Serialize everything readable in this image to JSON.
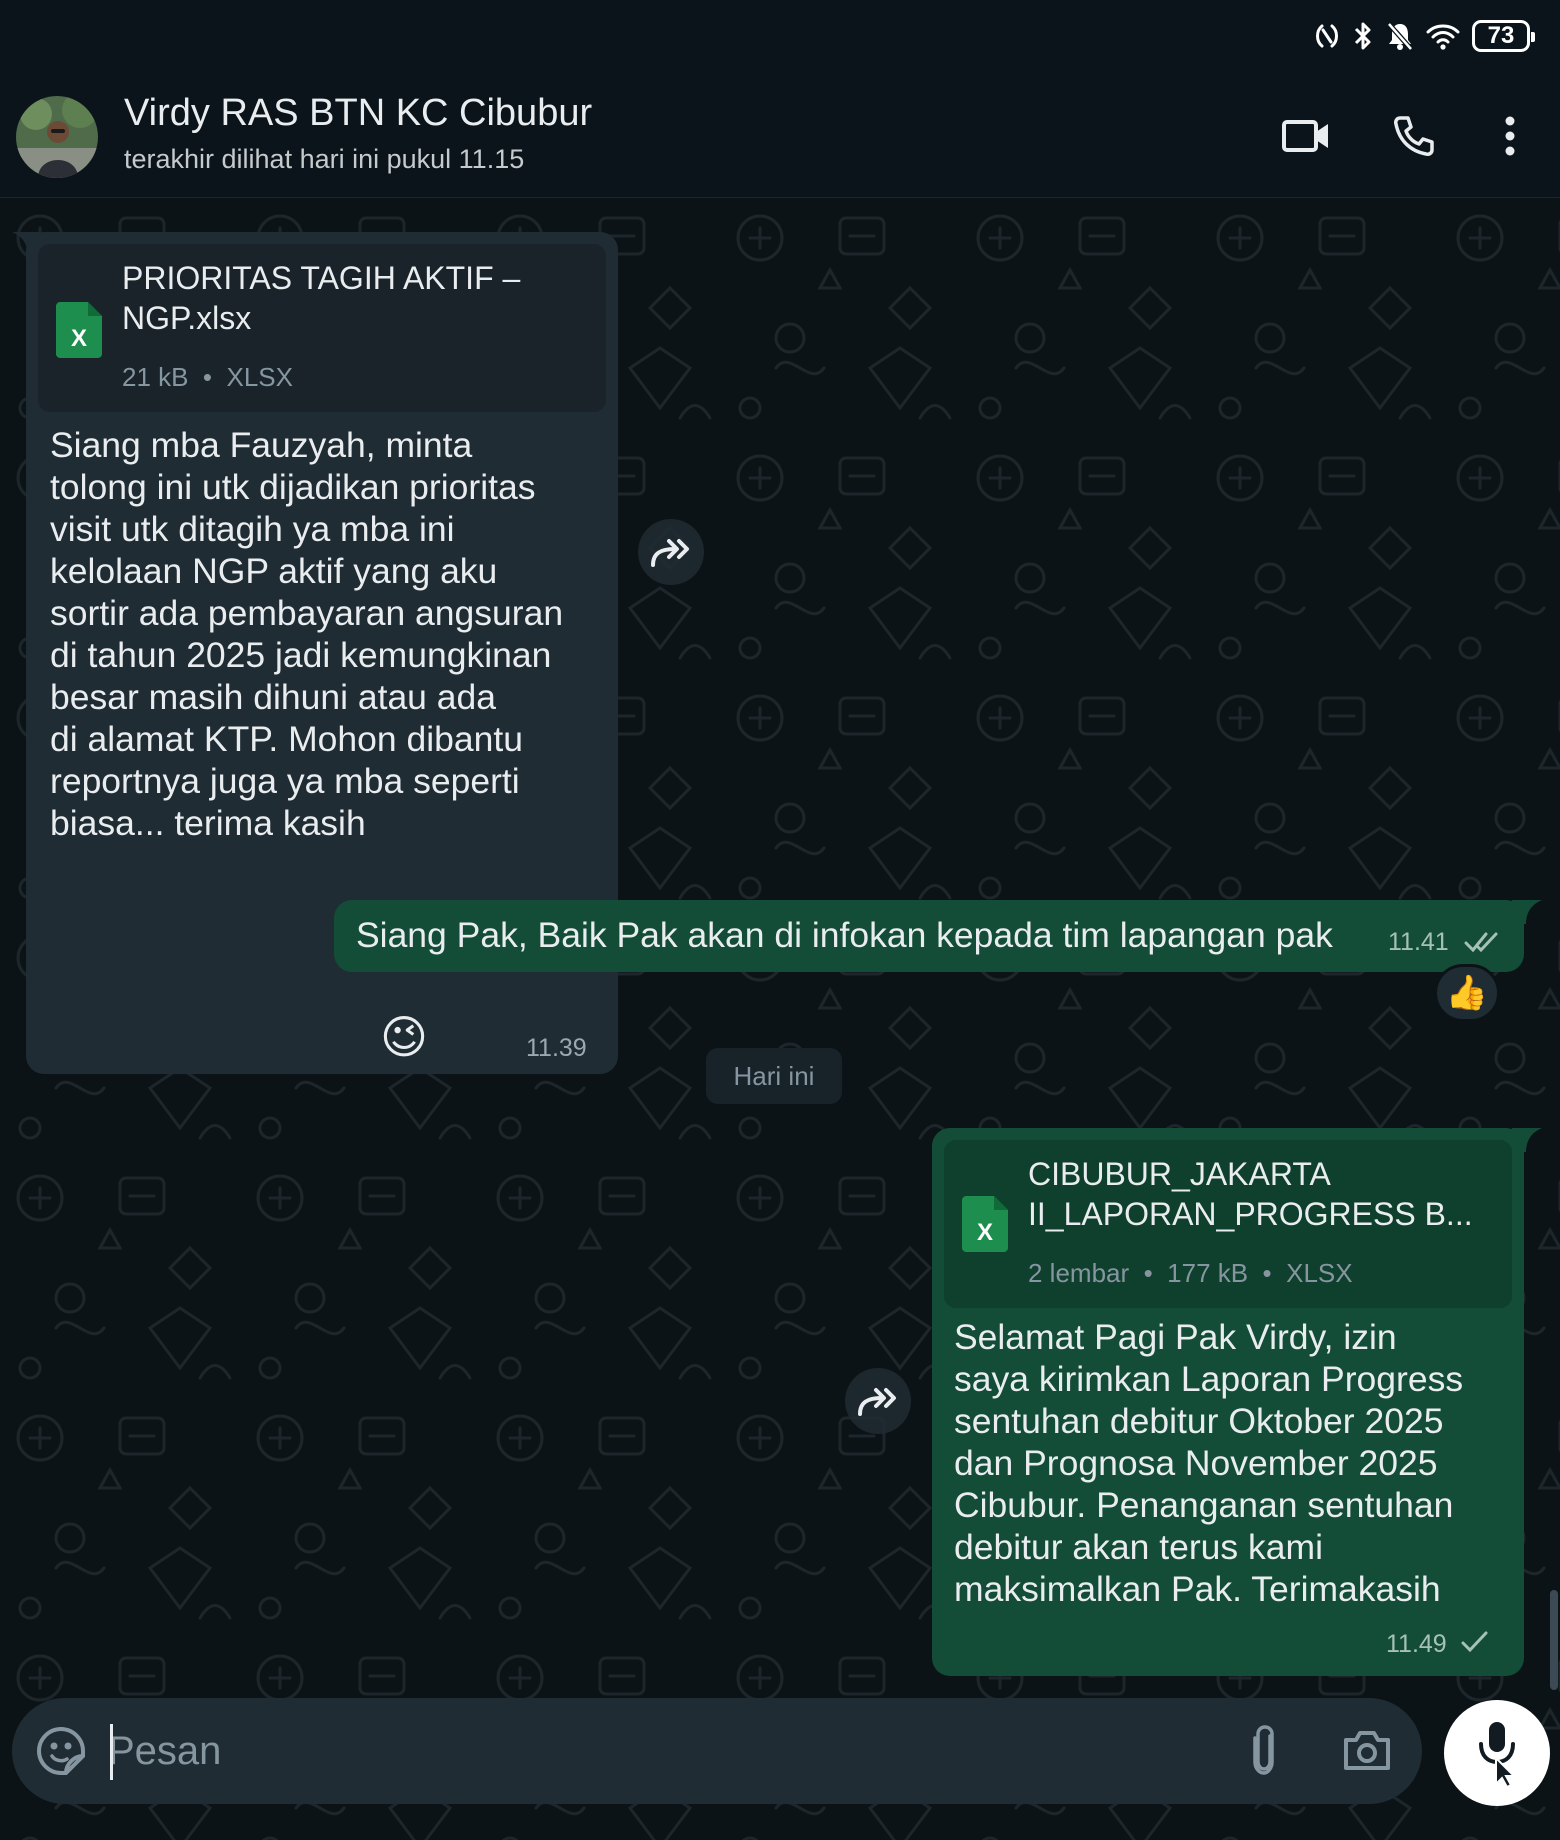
{
  "status_bar": {
    "battery": "73",
    "icons": [
      "nfc-icon",
      "bluetooth-icon",
      "bell-off-icon",
      "wifi-icon",
      "battery-icon"
    ]
  },
  "header": {
    "contact_name": "Virdy RAS BTN KC Cibubur",
    "last_seen": "terakhir dilihat hari ini pukul 11.15",
    "icons": [
      "video-call-icon",
      "voice-call-icon",
      "more-vert-icon"
    ]
  },
  "messages": [
    {
      "direction": "incoming",
      "document": {
        "name_line1": "PRIORITAS TAGIH AKTIF –",
        "name_line2": "NGP.xlsx",
        "meta": "21 kB  •  XLSX"
      },
      "text": "Siang mba Fauzyah, minta\ntolong ini utk dijadikan prioritas\nvisit utk ditagih ya mba ini\nkelolaan NGP aktif yang aku\nsortir ada pembayaran angsuran\ndi tahun 2025 jadi kemungkinan\nbesar masih dihuni atau ada\ndi alamat KTP. Mohon dibantu\nreportnya juga ya mba seperti\nbiasa... terima kasih",
      "emoji": "😉",
      "time": "11.39"
    },
    {
      "direction": "outgoing",
      "text": "Siang Pak, Baik Pak akan di infokan kepada tim lapangan pak",
      "time": "11.41",
      "status": "read",
      "reaction": "👍"
    },
    {
      "direction": "outgoing",
      "document": {
        "name_line1": "CIBUBUR_JAKARTA",
        "name_line2": "II_LAPORAN_PROGRESS B...",
        "meta": "2 lembar  •  177 kB  •  XLSX"
      },
      "text": "Selamat Pagi Pak Virdy, izin\nsaya kirimkan Laporan Progress\nsentuhan debitur Oktober 2025\ndan Prognosa November 2025\nCibubur. Penanganan sentuhan\ndebitur akan terus kami\nmaksimalkan Pak. Terimakasih",
      "time": "11.49",
      "status": "sent"
    }
  ],
  "date_separator": "Hari ini",
  "composer": {
    "placeholder": "Pesan",
    "icons": [
      "sticker-icon",
      "attach-icon",
      "camera-icon",
      "mic-icon"
    ]
  },
  "colors": {
    "background": "#0b141a",
    "incoming_bubble": "#202c33",
    "outgoing_bubble": "#144d37",
    "excel_green": "#1e8e4e",
    "read_tick": "#a6c2b4"
  }
}
